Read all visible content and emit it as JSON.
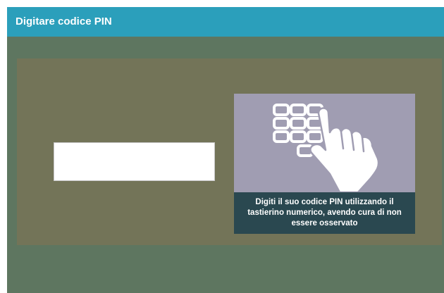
{
  "header": {
    "title": "Digitare codice PIN"
  },
  "pin_input": {
    "value": "",
    "placeholder": ""
  },
  "keypad_card": {
    "image_icon": "keypad-hand-icon",
    "instruction": "Digiti il suo codice PIN utilizzando il tastierino numerico, avendo cura di non essere osservato"
  },
  "colors": {
    "header": "#2b9fbb",
    "background": "#5e7660",
    "panel": "#737458",
    "illustration": "#a09db2",
    "caption": "#2a4850"
  }
}
